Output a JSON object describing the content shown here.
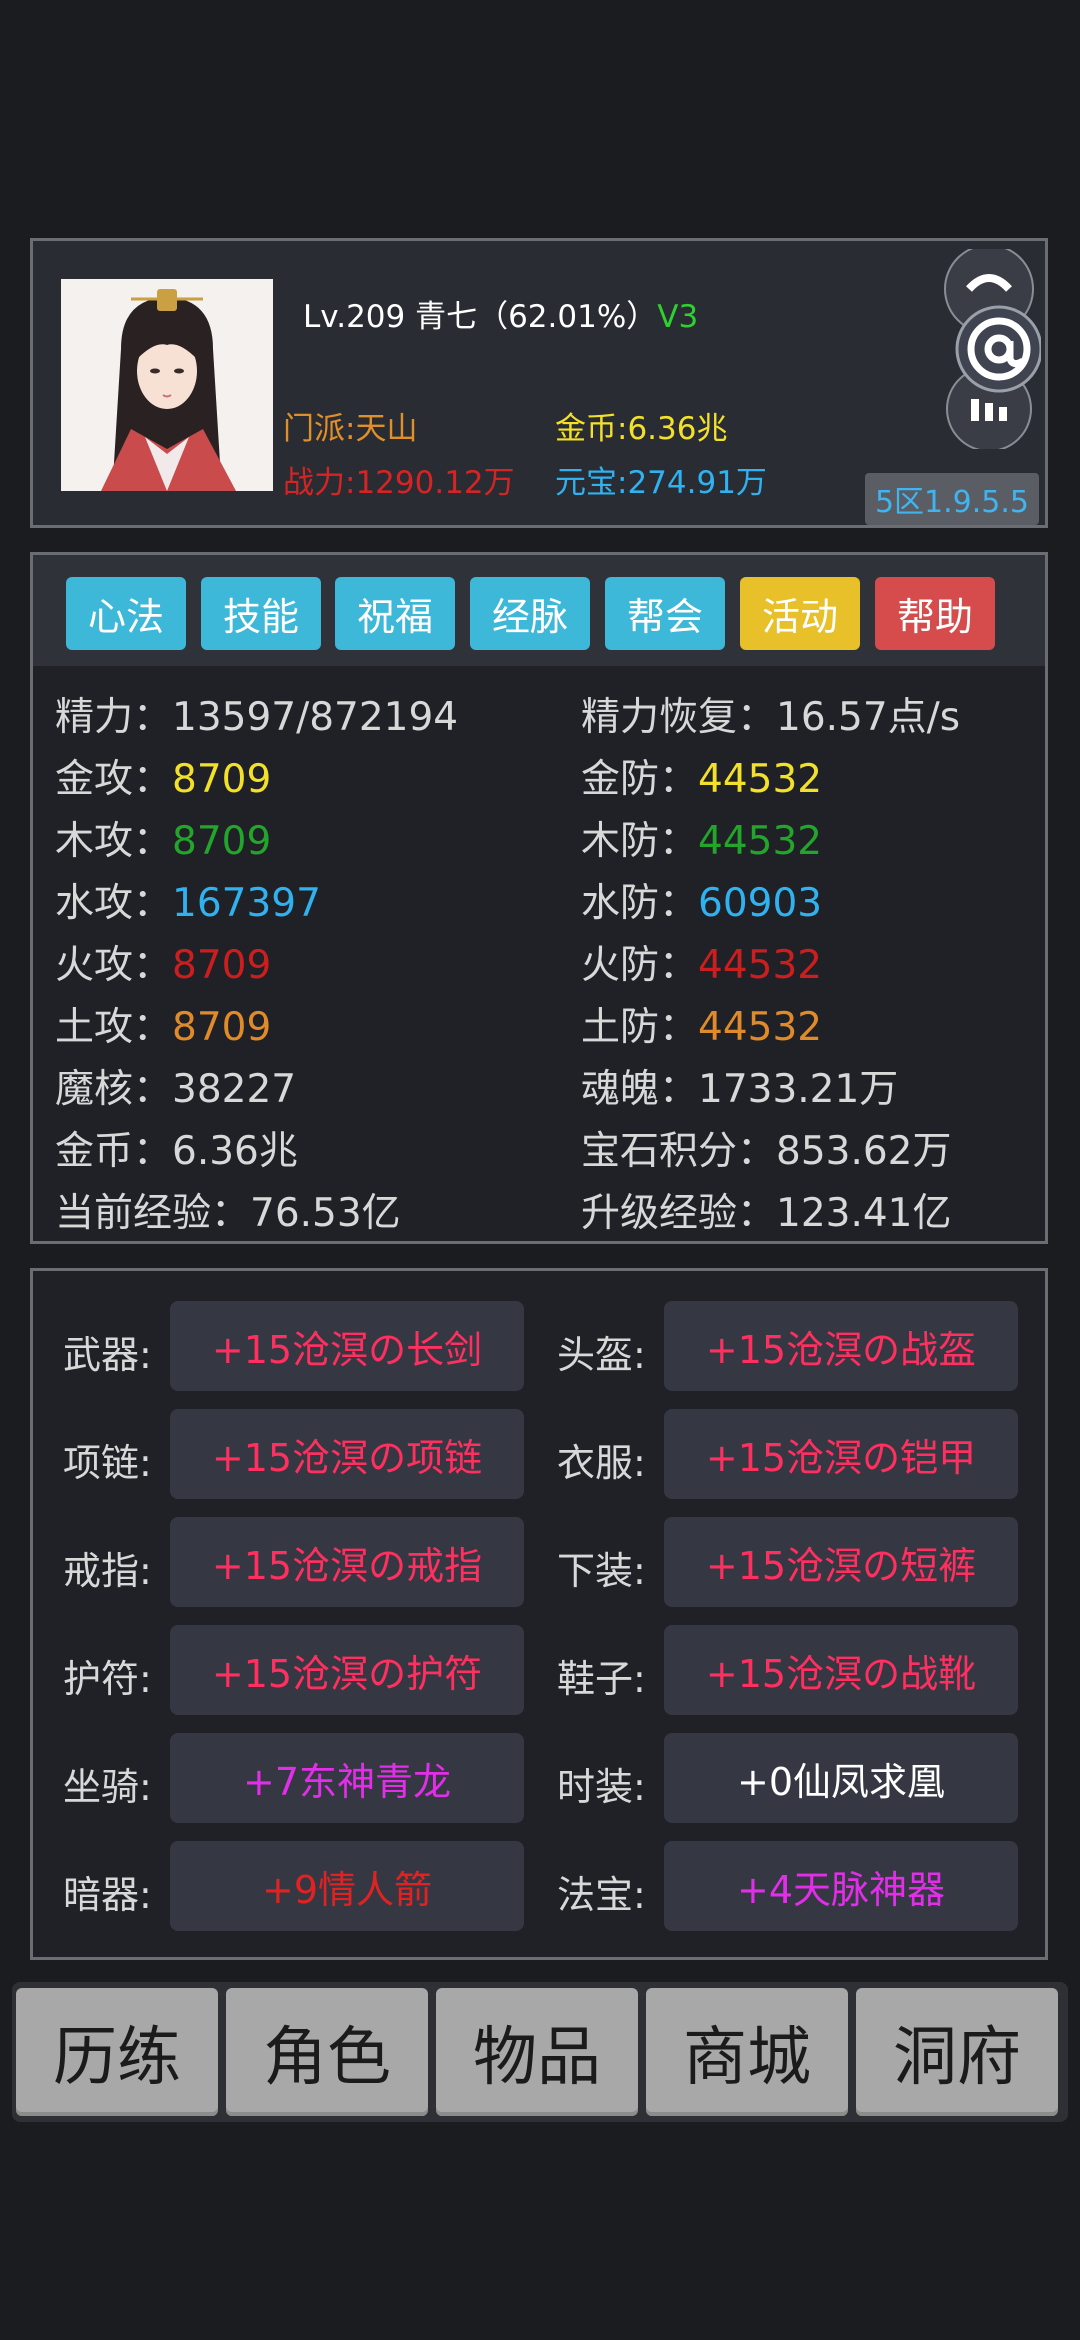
{
  "profile": {
    "level_name": "Lv.209 青七（62.01%）",
    "vip": "V3",
    "sect": "门派:天山",
    "power": "战力:1290.12万",
    "gold": "金币:6.36兆",
    "yuanbao": "元宝:274.91万",
    "server": "5区1.9.5.5"
  },
  "tabs": [
    {
      "label": "心法",
      "color": "#3db8d8"
    },
    {
      "label": "技能",
      "color": "#3db8d8"
    },
    {
      "label": "祝福",
      "color": "#3db8d8"
    },
    {
      "label": "经脉",
      "color": "#3db8d8"
    },
    {
      "label": "帮会",
      "color": "#3db8d8"
    },
    {
      "label": "活动",
      "color": "#e8c02a"
    },
    {
      "label": "帮助",
      "color": "#d64b4b"
    }
  ],
  "stats": [
    {
      "label": "精力：",
      "value": "13597/872194",
      "color": "#d8d8d8"
    },
    {
      "label": "精力恢复：",
      "value": "16.57点/s",
      "color": "#d8d8d8"
    },
    {
      "label": "金攻：",
      "value": "8709",
      "color": "#f2e02a"
    },
    {
      "label": "金防：",
      "value": "44532",
      "color": "#f2e02a"
    },
    {
      "label": "木攻：",
      "value": "8709",
      "color": "#22a52a"
    },
    {
      "label": "木防：",
      "value": "44532",
      "color": "#22a52a"
    },
    {
      "label": "水攻：",
      "value": "167397",
      "color": "#2fb2ef"
    },
    {
      "label": "水防：",
      "value": "60903",
      "color": "#2fb2ef"
    },
    {
      "label": "火攻：",
      "value": "8709",
      "color": "#cc1e1e"
    },
    {
      "label": "火防：",
      "value": "44532",
      "color": "#cc1e1e"
    },
    {
      "label": "土攻：",
      "value": "8709",
      "color": "#e08a2a"
    },
    {
      "label": "土防：",
      "value": "44532",
      "color": "#e08a2a"
    },
    {
      "label": "魔核：",
      "value": "38227",
      "color": "#d8d8d8"
    },
    {
      "label": "魂魄：",
      "value": "1733.21万",
      "color": "#d8d8d8"
    },
    {
      "label": "金币：",
      "value": "6.36兆",
      "color": "#d8d8d8"
    },
    {
      "label": "宝石积分：",
      "value": "853.62万",
      "color": "#d8d8d8"
    },
    {
      "label": "当前经验：",
      "value": "76.53亿",
      "color": "#d8d8d8"
    },
    {
      "label": "升级经验：",
      "value": "123.41亿",
      "color": "#d8d8d8"
    }
  ],
  "equipment": [
    {
      "slot": "武器:",
      "item": "+15沧溟の长剑",
      "color": "#ff2f5f"
    },
    {
      "slot": "头盔:",
      "item": "+15沧溟の战盔",
      "color": "#ff2f5f"
    },
    {
      "slot": "项链:",
      "item": "+15沧溟の项链",
      "color": "#ff2f5f"
    },
    {
      "slot": "衣服:",
      "item": "+15沧溟の铠甲",
      "color": "#ff2f5f"
    },
    {
      "slot": "戒指:",
      "item": "+15沧溟の戒指",
      "color": "#ff2f5f"
    },
    {
      "slot": "下装:",
      "item": "+15沧溟の短裤",
      "color": "#ff2f5f"
    },
    {
      "slot": "护符:",
      "item": "+15沧溟の护符",
      "color": "#ff2f5f"
    },
    {
      "slot": "鞋子:",
      "item": "+15沧溟の战靴",
      "color": "#ff2f5f"
    },
    {
      "slot": "坐骑:",
      "item": "+7东神青龙",
      "color": "#e22ee8"
    },
    {
      "slot": "时装:",
      "item": "+0仙凤求凰",
      "color": "#ffffff"
    },
    {
      "slot": "暗器:",
      "item": "+9情人箭",
      "color": "#e02222"
    },
    {
      "slot": "法宝:",
      "item": "+4天脉神器",
      "color": "#e22ee8"
    }
  ],
  "nav": [
    "历练",
    "角色",
    "物品",
    "商城",
    "洞府"
  ]
}
